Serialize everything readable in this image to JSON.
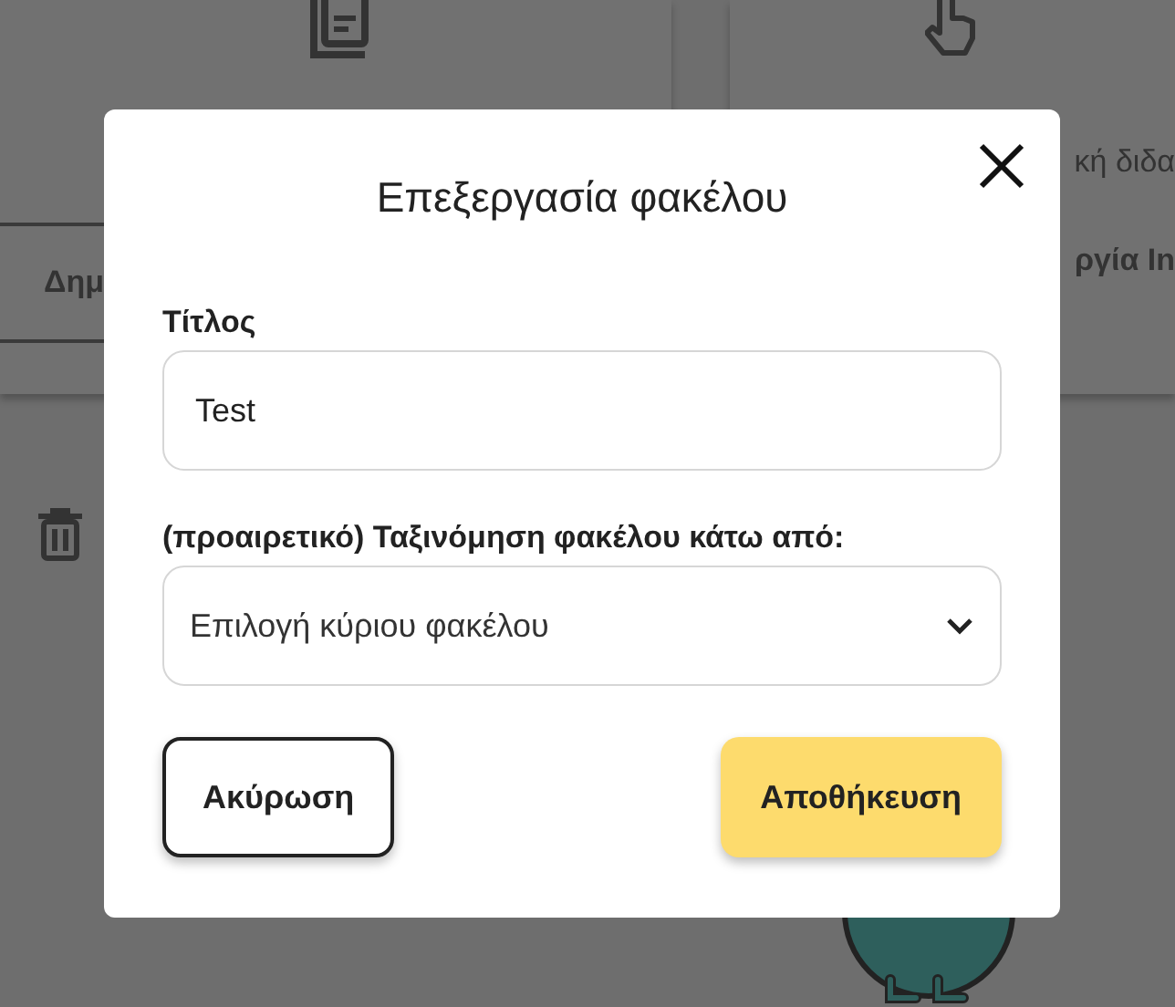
{
  "background": {
    "cards": [
      {
        "button": "Δημ"
      },
      {
        "description_lines": [
          "κή διδα"
        ],
        "button": "ργία In"
      }
    ]
  },
  "modal": {
    "title": "Επεξεργασία φακέλου",
    "fields": [
      {
        "kind": "text",
        "label": "Τίτλος",
        "value": "Test"
      },
      {
        "kind": "select",
        "label": "(προαιρετικό) Ταξινόμηση φακέλου κάτω από:",
        "value": "Επιλογή κύριου φακέλου"
      }
    ],
    "buttons": [
      {
        "label": "Ακύρωση",
        "kind": "secondary"
      },
      {
        "label": "Αποθήκευση",
        "kind": "primary"
      }
    ]
  }
}
